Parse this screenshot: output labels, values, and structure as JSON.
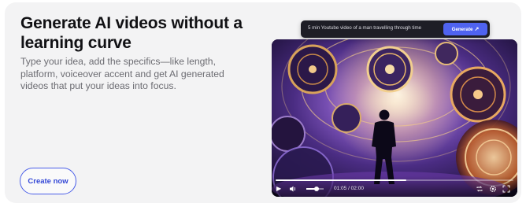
{
  "hero": {
    "headline": "Generate AI videos without a learning curve",
    "description": "Type your idea, add the specifics—like length, platform, voiceover accent and get AI generated videos that put your ideas into focus.",
    "cta_label": "Create now"
  },
  "prompt_bar": {
    "prompt_text": "5 min Youtube video of a man travelling through time",
    "generate_label": "Generate",
    "generate_icon": "magic-wand-icon"
  },
  "video_player": {
    "time_display": "01:05 / 02:00",
    "progress_fraction": 0.55,
    "volume_fraction": 0.6,
    "icons": [
      "play-icon",
      "volume-icon",
      "loop-icon",
      "settings-icon",
      "fullscreen-icon"
    ]
  },
  "colors": {
    "accent": "#4f63f0",
    "cta_border": "#4a5ee8",
    "card_bg": "#f3f3f4",
    "prompt_bg": "#1e1e26"
  }
}
